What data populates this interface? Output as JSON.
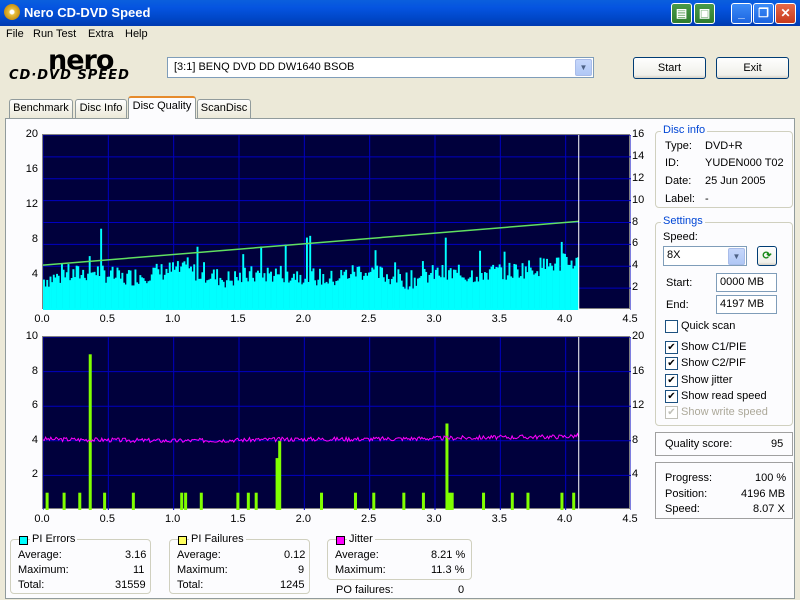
{
  "window": {
    "title": "Nero CD-DVD Speed"
  },
  "menu": [
    "File",
    "Run Test",
    "Extra",
    "Help"
  ],
  "logo": {
    "main": "nero",
    "sub": "CD·DVD SPEED"
  },
  "drive": {
    "selected": "[3:1]  BENQ DVD DD DW1640 BSOB"
  },
  "buttons": {
    "start": "Start",
    "exit": "Exit"
  },
  "tabs": [
    "Benchmark",
    "Disc Info",
    "Disc Quality",
    "ScanDisc"
  ],
  "active_tab": "Disc Quality",
  "colors": {
    "pie": "#00ffff",
    "pif": "#80ff00",
    "jitter": "#ff00ff",
    "speed": "#60e060",
    "plot_bg": "#00003c",
    "grid": "#0000c0"
  },
  "chart_data": [
    {
      "type": "area",
      "title": "",
      "xlabel": "",
      "ylabel": "",
      "xlim": [
        0,
        4.5
      ],
      "ylim": [
        0,
        20
      ],
      "y2lim": [
        0,
        16
      ],
      "x_ticks": [
        "0.0",
        "0.5",
        "1.0",
        "1.5",
        "2.0",
        "2.5",
        "3.0",
        "3.5",
        "4.0",
        "4.5"
      ],
      "y_ticks": [
        "20",
        "16",
        "12",
        "8",
        "4"
      ],
      "y2_ticks": [
        "16",
        "14",
        "12",
        "10",
        "8",
        "6",
        "4",
        "2"
      ],
      "grid": true,
      "series": [
        {
          "name": "PI Errors",
          "x": [
            0.0,
            0.2,
            0.4,
            0.6,
            0.8,
            1.0,
            1.2,
            1.4,
            1.6,
            1.8,
            2.0,
            2.2,
            2.4,
            2.6,
            2.8,
            3.0,
            3.2,
            3.4,
            3.6,
            3.8,
            4.0,
            4.1
          ],
          "values": [
            3.5,
            4.0,
            4.5,
            3.6,
            4.2,
            4.6,
            4.3,
            3.5,
            4.0,
            4.2,
            4.0,
            3.5,
            4.5,
            4.0,
            3.4,
            4.2,
            4.0,
            4.3,
            4.5,
            5.0,
            5.5,
            5.5
          ]
        },
        {
          "name": "Read speed",
          "x": [
            0.0,
            4.1
          ],
          "values": [
            4.1,
            8.1
          ]
        }
      ]
    },
    {
      "type": "bar",
      "title": "",
      "xlabel": "",
      "ylabel": "",
      "xlim": [
        0,
        4.5
      ],
      "ylim": [
        0,
        10
      ],
      "y2lim": [
        0,
        20
      ],
      "x_ticks": [
        "0.0",
        "0.5",
        "1.0",
        "1.5",
        "2.0",
        "2.5",
        "3.0",
        "3.5",
        "4.0",
        "4.5"
      ],
      "y_ticks": [
        "10",
        "8",
        "6",
        "4",
        "2"
      ],
      "y2_ticks": [
        "20",
        "16",
        "12",
        "8",
        "4"
      ],
      "grid": true,
      "series": [
        {
          "name": "PI Failures",
          "x": [
            0.02,
            0.15,
            0.27,
            0.35,
            0.46,
            0.68,
            1.05,
            1.08,
            1.2,
            1.48,
            1.56,
            1.62,
            1.78,
            1.8,
            2.12,
            2.38,
            2.52,
            2.75,
            2.9,
            3.08,
            3.1,
            3.12,
            3.36,
            3.58,
            3.7,
            3.96,
            4.05
          ],
          "values": [
            1,
            1,
            1,
            9,
            1,
            1,
            1,
            1,
            1,
            1,
            1,
            1,
            3,
            4,
            1,
            1,
            1,
            1,
            1,
            5,
            1,
            1,
            1,
            1,
            1,
            1,
            1
          ]
        },
        {
          "name": "Jitter",
          "x": [
            0.0,
            0.5,
            1.0,
            1.5,
            2.0,
            2.5,
            3.0,
            3.5,
            4.0,
            4.1
          ],
          "values": [
            8.2,
            8.1,
            8.0,
            8.1,
            8.2,
            8.2,
            8.3,
            8.4,
            8.5,
            8.6
          ]
        }
      ]
    }
  ],
  "disc_info": {
    "label": "Disc info",
    "type_label": "Type:",
    "type": "DVD+R",
    "id_label": "ID:",
    "id": "YUDEN000 T02",
    "date_label": "Date:",
    "date": "25 Jun 2005",
    "disc_label_label": "Label:",
    "disc_label": "-"
  },
  "settings": {
    "label": "Settings",
    "speed_label": "Speed:",
    "speed": "8X",
    "start_label": "Start:",
    "start": "0000 MB",
    "end_label": "End:",
    "end": "4197 MB",
    "quick_scan": "Quick scan",
    "show_c1": "Show C1/PIE",
    "show_c2": "Show C2/PIF",
    "show_jitter": "Show jitter",
    "show_read": "Show read speed",
    "show_write": "Show write speed"
  },
  "quality": {
    "label": "Quality score:",
    "value": "95"
  },
  "progress": {
    "progress_label": "Progress:",
    "progress": "100 %",
    "position_label": "Position:",
    "position": "4196 MB",
    "speed_label": "Speed:",
    "speed": "8.07 X"
  },
  "stats": {
    "pi_errors": {
      "label": "PI Errors",
      "avg_label": "Average:",
      "avg": "3.16",
      "max_label": "Maximum:",
      "max": "11",
      "total_label": "Total:",
      "total": "31559"
    },
    "pi_failures": {
      "label": "PI Failures",
      "avg_label": "Average:",
      "avg": "0.12",
      "max_label": "Maximum:",
      "max": "9",
      "total_label": "Total:",
      "total": "1245"
    },
    "jitter": {
      "label": "Jitter",
      "avg_label": "Average:",
      "avg": "8.21 %",
      "max_label": "Maximum:",
      "max": "11.3 %"
    },
    "po_label": "PO failures:",
    "po": "0"
  }
}
